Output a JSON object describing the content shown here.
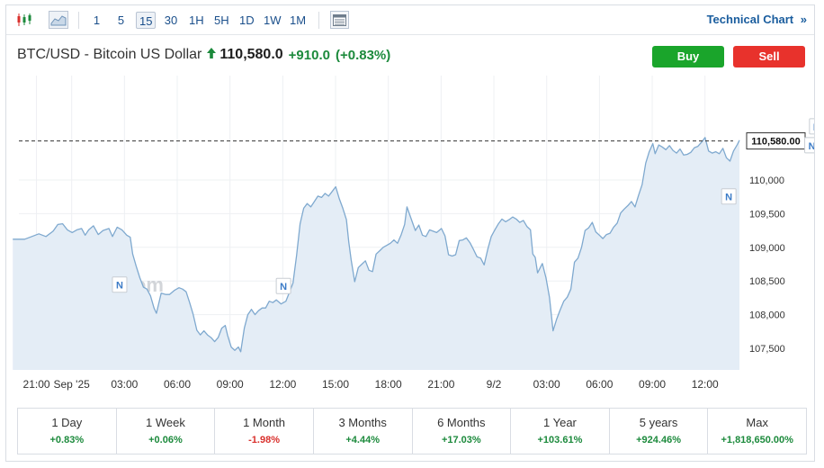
{
  "toolbar": {
    "icons": [
      "candlestick-icon",
      "area-chart-icon",
      "table-icon"
    ],
    "intervals": [
      "1",
      "5",
      "15",
      "30",
      "1H",
      "5H",
      "1D",
      "1W",
      "1M"
    ],
    "active_interval": "15",
    "technical_chart_label": "Technical Chart",
    "technical_chart_arrow": "»"
  },
  "header": {
    "pair": "BTC/USD - Bitcoin US Dollar",
    "last": "110,580.0",
    "change": "+910.0",
    "change_pct": "(+0.83%)",
    "buy_label": "Buy",
    "sell_label": "Sell"
  },
  "colors": {
    "positive": "#1c8a3c",
    "negative": "#d9302c",
    "line": "#7fa9cf",
    "fill": "#e4edf6",
    "buy": "#1aa52b",
    "sell": "#e8322c",
    "news_marker": "#3b7bc7"
  },
  "chart_data": {
    "type": "area",
    "title": "",
    "watermark": "Investing.com",
    "x_tick_labels": [
      "21:00",
      "Sep '25",
      "03:00",
      "06:00",
      "09:00",
      "12:00",
      "15:00",
      "18:00",
      "21:00",
      "9/2",
      "03:00",
      "06:00",
      "09:00",
      "12:00"
    ],
    "x_range_hours": [
      -1,
      39.6
    ],
    "y_ticks": [
      107500,
      108000,
      108500,
      109000,
      109500,
      110000
    ],
    "y_tick_labels": [
      "107,500",
      "108,000",
      "108,500",
      "109,000",
      "109,500",
      "110,000"
    ],
    "ylim": [
      107180,
      111550
    ],
    "last_price": 110580,
    "last_price_label": "110,580.00",
    "news_marker_label": "N",
    "news_markers": [
      {
        "t": 3.5,
        "y": 108440
      },
      {
        "t": 10.4,
        "y": 108420
      },
      {
        "t": 29.15,
        "y": 109750
      },
      {
        "t": 32.65,
        "y": 110510
      },
      {
        "t": 32.85,
        "y": 110790
      }
    ],
    "series": [
      {
        "points": [
          [
            -1,
            109120
          ],
          [
            -0.5,
            109120
          ],
          [
            -0.2,
            109160
          ],
          [
            0.1,
            109200
          ],
          [
            0.4,
            109160
          ],
          [
            0.7,
            109240
          ],
          [
            0.9,
            109340
          ],
          [
            1.1,
            109350
          ],
          [
            1.3,
            109260
          ],
          [
            1.5,
            109220
          ],
          [
            1.7,
            109260
          ],
          [
            1.9,
            109280
          ],
          [
            2.05,
            109180
          ],
          [
            2.2,
            109260
          ],
          [
            2.4,
            109320
          ],
          [
            2.6,
            109190
          ],
          [
            2.8,
            109250
          ],
          [
            3.05,
            109280
          ],
          [
            3.2,
            109160
          ],
          [
            3.4,
            109300
          ],
          [
            3.6,
            109260
          ],
          [
            3.8,
            109180
          ],
          [
            3.95,
            109150
          ],
          [
            4.05,
            108900
          ],
          [
            4.2,
            108720
          ],
          [
            4.35,
            108550
          ],
          [
            4.5,
            108410
          ],
          [
            4.65,
            108380
          ],
          [
            4.8,
            108280
          ],
          [
            4.95,
            108100
          ],
          [
            5.05,
            108020
          ],
          [
            5.25,
            108320
          ],
          [
            5.45,
            108300
          ],
          [
            5.6,
            108300
          ],
          [
            5.8,
            108360
          ],
          [
            6,
            108400
          ],
          [
            6.15,
            108380
          ],
          [
            6.3,
            108340
          ],
          [
            6.45,
            108180
          ],
          [
            6.6,
            108000
          ],
          [
            6.75,
            107770
          ],
          [
            6.9,
            107700
          ],
          [
            7.05,
            107760
          ],
          [
            7.2,
            107700
          ],
          [
            7.35,
            107660
          ],
          [
            7.5,
            107600
          ],
          [
            7.65,
            107660
          ],
          [
            7.8,
            107800
          ],
          [
            7.95,
            107840
          ],
          [
            8.05,
            107690
          ],
          [
            8.2,
            107520
          ],
          [
            8.35,
            107470
          ],
          [
            8.5,
            107520
          ],
          [
            8.6,
            107450
          ],
          [
            8.75,
            107800
          ],
          [
            8.9,
            108000
          ],
          [
            9.05,
            108080
          ],
          [
            9.2,
            108000
          ],
          [
            9.35,
            108060
          ],
          [
            9.5,
            108100
          ],
          [
            9.65,
            108100
          ],
          [
            9.8,
            108200
          ],
          [
            9.95,
            108180
          ],
          [
            10.1,
            108220
          ],
          [
            10.3,
            108160
          ],
          [
            10.5,
            108200
          ],
          [
            10.65,
            108330
          ],
          [
            10.8,
            108470
          ],
          [
            10.95,
            108880
          ],
          [
            11.1,
            109350
          ],
          [
            11.25,
            109580
          ],
          [
            11.4,
            109650
          ],
          [
            11.55,
            109600
          ],
          [
            11.7,
            109680
          ],
          [
            11.85,
            109760
          ],
          [
            12,
            109740
          ],
          [
            12.15,
            109800
          ],
          [
            12.3,
            109760
          ],
          [
            12.45,
            109830
          ],
          [
            12.6,
            109900
          ],
          [
            12.75,
            109720
          ],
          [
            12.9,
            109580
          ],
          [
            13.05,
            109410
          ],
          [
            13.15,
            109080
          ],
          [
            13.25,
            108810
          ],
          [
            13.4,
            108490
          ],
          [
            13.55,
            108700
          ],
          [
            13.7,
            108750
          ],
          [
            13.85,
            108800
          ],
          [
            14,
            108660
          ],
          [
            14.15,
            108640
          ],
          [
            14.3,
            108900
          ],
          [
            14.45,
            108950
          ],
          [
            14.6,
            109000
          ],
          [
            14.75,
            109030
          ],
          [
            14.9,
            109060
          ],
          [
            15.05,
            109110
          ],
          [
            15.2,
            109060
          ],
          [
            15.35,
            109180
          ],
          [
            15.5,
            109340
          ],
          [
            15.6,
            109600
          ],
          [
            15.8,
            109400
          ],
          [
            15.95,
            109250
          ],
          [
            16.1,
            109330
          ],
          [
            16.25,
            109180
          ],
          [
            16.4,
            109160
          ],
          [
            16.55,
            109260
          ],
          [
            16.7,
            109240
          ],
          [
            16.85,
            109220
          ],
          [
            17.05,
            109280
          ],
          [
            17.2,
            109170
          ],
          [
            17.35,
            108890
          ],
          [
            17.5,
            108870
          ],
          [
            17.65,
            108890
          ],
          [
            17.8,
            109100
          ],
          [
            17.95,
            109110
          ],
          [
            18.1,
            109140
          ],
          [
            18.25,
            109070
          ],
          [
            18.4,
            108970
          ],
          [
            18.55,
            108860
          ],
          [
            18.7,
            108840
          ],
          [
            18.85,
            108740
          ],
          [
            19,
            108970
          ],
          [
            19.15,
            109160
          ],
          [
            19.3,
            109260
          ],
          [
            19.45,
            109350
          ],
          [
            19.6,
            109420
          ],
          [
            19.75,
            109380
          ],
          [
            19.9,
            109410
          ],
          [
            20.05,
            109450
          ],
          [
            20.2,
            109420
          ],
          [
            20.35,
            109370
          ],
          [
            20.5,
            109400
          ],
          [
            20.65,
            109310
          ],
          [
            20.8,
            109260
          ],
          [
            20.9,
            108900
          ],
          [
            21,
            108850
          ],
          [
            21.1,
            108620
          ],
          [
            21.3,
            108760
          ],
          [
            21.45,
            108550
          ],
          [
            21.6,
            108260
          ],
          [
            21.75,
            107760
          ],
          [
            21.9,
            107930
          ],
          [
            22.05,
            108070
          ],
          [
            22.2,
            108200
          ],
          [
            22.35,
            108260
          ],
          [
            22.5,
            108380
          ],
          [
            22.65,
            108780
          ],
          [
            22.8,
            108840
          ],
          [
            22.95,
            109000
          ],
          [
            23.1,
            109250
          ],
          [
            23.25,
            109290
          ],
          [
            23.4,
            109370
          ],
          [
            23.55,
            109230
          ],
          [
            23.7,
            109180
          ],
          [
            23.85,
            109130
          ],
          [
            24,
            109190
          ],
          [
            24.15,
            109210
          ],
          [
            24.3,
            109300
          ],
          [
            24.45,
            109360
          ],
          [
            24.6,
            109510
          ],
          [
            24.75,
            109570
          ],
          [
            24.9,
            109620
          ],
          [
            25.05,
            109680
          ],
          [
            25.2,
            109600
          ],
          [
            25.35,
            109770
          ],
          [
            25.5,
            109930
          ],
          [
            25.65,
            110250
          ],
          [
            25.8,
            110420
          ],
          [
            25.95,
            110540
          ],
          [
            26.05,
            110390
          ],
          [
            26.2,
            110520
          ],
          [
            26.35,
            110490
          ],
          [
            26.5,
            110450
          ],
          [
            26.65,
            110510
          ],
          [
            26.8,
            110440
          ],
          [
            26.95,
            110400
          ],
          [
            27.1,
            110460
          ],
          [
            27.25,
            110370
          ],
          [
            27.4,
            110380
          ],
          [
            27.55,
            110410
          ],
          [
            27.7,
            110480
          ],
          [
            27.85,
            110500
          ],
          [
            28,
            110560
          ],
          [
            28.15,
            110630
          ],
          [
            28.3,
            110430
          ],
          [
            28.45,
            110400
          ],
          [
            28.6,
            110420
          ],
          [
            28.75,
            110390
          ],
          [
            28.9,
            110470
          ],
          [
            29.05,
            110330
          ],
          [
            29.2,
            110280
          ],
          [
            29.35,
            110430
          ],
          [
            29.5,
            110520
          ],
          [
            29.6,
            110590
          ]
        ]
      }
    ]
  },
  "performance": [
    {
      "label": "1 Day",
      "value": "+0.83%",
      "dir": "pos"
    },
    {
      "label": "1 Week",
      "value": "+0.06%",
      "dir": "pos"
    },
    {
      "label": "1 Month",
      "value": "-1.98%",
      "dir": "neg"
    },
    {
      "label": "3 Months",
      "value": "+4.44%",
      "dir": "pos"
    },
    {
      "label": "6 Months",
      "value": "+17.03%",
      "dir": "pos"
    },
    {
      "label": "1 Year",
      "value": "+103.61%",
      "dir": "pos"
    },
    {
      "label": "5 years",
      "value": "+924.46%",
      "dir": "pos"
    },
    {
      "label": "Max",
      "value": "+1,818,650.00%",
      "dir": "pos"
    }
  ]
}
